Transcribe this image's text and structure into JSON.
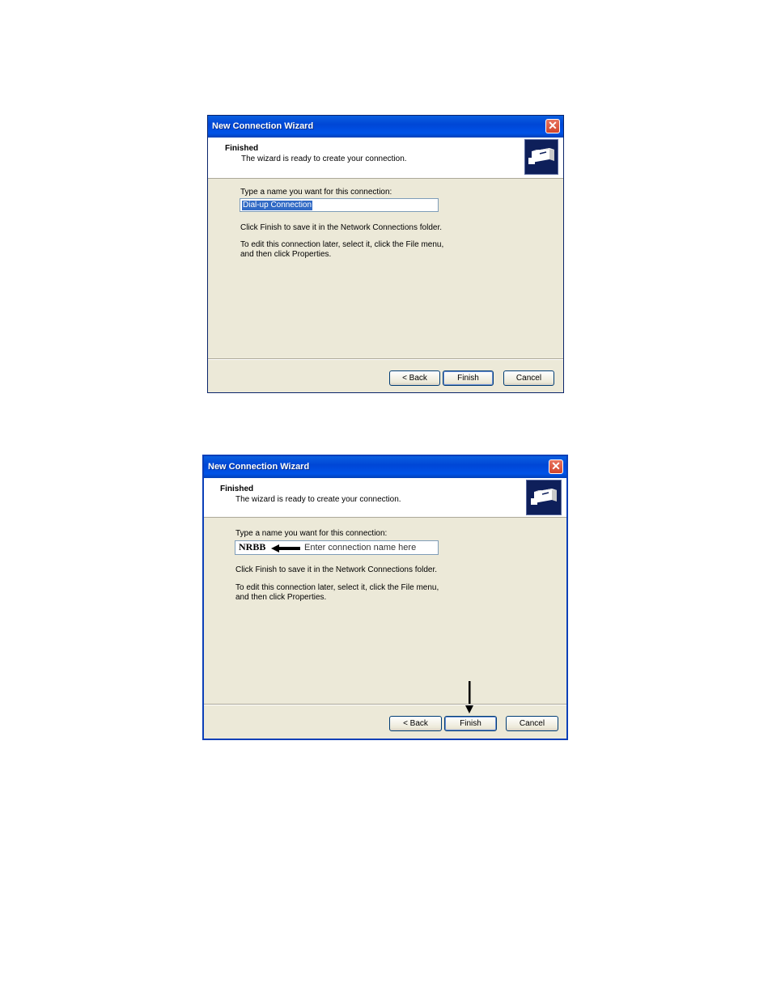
{
  "dialog_top": {
    "window_title": "New Connection Wizard",
    "close_label": "✕",
    "header_title": "Finished",
    "header_subtitle": "The wizard is ready to create your connection.",
    "name_prompt": "Type a name you want for this connection:",
    "name_value": "Dial-up Connection",
    "finish_note": "Click Finish to save it in the Network Connections folder.",
    "edit_note_line1": "To edit this connection later, select it, click the File menu,",
    "edit_note_line2": "and then click Properties.",
    "back_label": "< Back",
    "finish_label": "Finish",
    "cancel_label": "Cancel"
  },
  "dialog_bottom": {
    "window_title": "New Connection Wizard",
    "close_label": "✕",
    "header_title": "Finished",
    "header_subtitle": "The wizard is ready to create your connection.",
    "name_prompt": "Type a name you want for this connection:",
    "name_value": "NRBB",
    "annotation_hint": "Enter connection name here",
    "finish_note": "Click Finish to save it in the Network Connections folder.",
    "edit_note_line1": "To edit this connection later, select it, click the File menu,",
    "edit_note_line2": "and then click Properties.",
    "back_label": "< Back",
    "finish_label": "Finish",
    "cancel_label": "Cancel"
  },
  "icons": {
    "wizard_logo": "network-connection-icon",
    "close": "close-icon",
    "annotation_left_arrow": "arrow-left-icon",
    "annotation_down_arrow": "arrow-down-icon"
  },
  "colors": {
    "title_bar": "#0054e3",
    "dialog_face": "#ece9d8",
    "selection": "#316ac5",
    "close_button": "#d2452c"
  }
}
